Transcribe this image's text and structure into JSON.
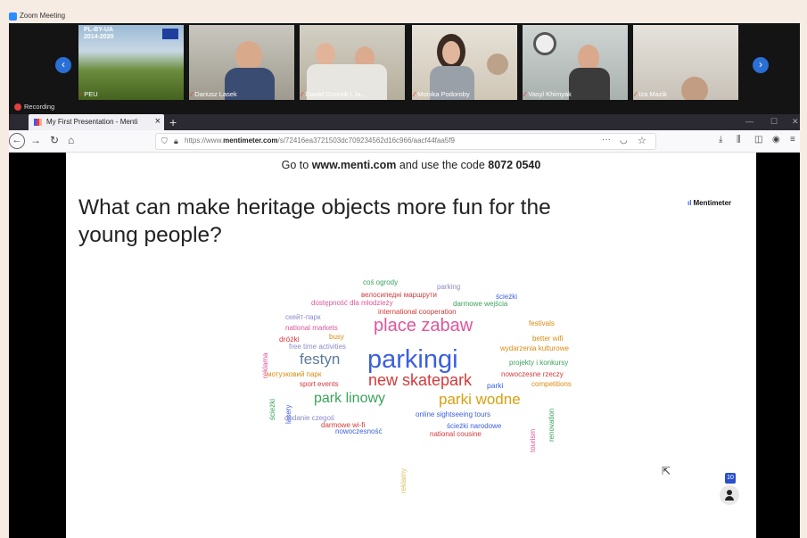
{
  "zoom": {
    "window_title": "Zoom Meeting",
    "recording_label": "Recording",
    "participants": [
      {
        "name": "PEU"
      },
      {
        "name": "Dariusz Lasek"
      },
      {
        "name": "Dawid Grzesik i Ja..."
      },
      {
        "name": "Monika Podoroby"
      },
      {
        "name": "Vasyl Khimyak"
      },
      {
        "name": "Iza Mazik"
      }
    ],
    "banner_text": {
      "line1": "PL-BY-UA",
      "line2": "2014-2020"
    }
  },
  "browser": {
    "tab_title": "My First Presentation - Menti",
    "url_prefix": "https://www.",
    "url_domain": "mentimeter.com",
    "url_path": "/s/72416ea3721503dc709234562d16c966/aacf44faa5f9"
  },
  "slide": {
    "join_text_pre": "Go to ",
    "join_site": "www.menti.com",
    "join_text_mid": " and use the code ",
    "join_code": "8072 0540",
    "question_line1": "What can make heritage objects more fun for the",
    "question_line2": "young people?",
    "brand": "Mentimeter",
    "participant_count": "10"
  },
  "word_cloud": [
    {
      "text": "coś ogrody",
      "color": "#3aa35a"
    },
    {
      "text": "parking",
      "color": "#8a8acd"
    },
    {
      "text": "велосипедні маршрути",
      "color": "#d43a3a"
    },
    {
      "text": "ścieżki",
      "color": "#3b5fe0"
    },
    {
      "text": "dostępność dla młodzieży",
      "color": "#e0559a"
    },
    {
      "text": "darmowe wejścia",
      "color": "#3aa35a"
    },
    {
      "text": "international cooperation",
      "color": "#d43a3a"
    },
    {
      "text": "скейт-парк",
      "color": "#8a8acd"
    },
    {
      "text": "festivals",
      "color": "#d98b10"
    },
    {
      "text": "national markets",
      "color": "#e0559a"
    },
    {
      "text": "place zabaw",
      "color": "#e0559a"
    },
    {
      "text": "dróżki",
      "color": "#d43a3a"
    },
    {
      "text": "busy",
      "color": "#d98b10"
    },
    {
      "text": "better wifi",
      "color": "#d98b10"
    },
    {
      "text": "free time activities",
      "color": "#8a8acd"
    },
    {
      "text": "wydarzenia kulturowe",
      "color": "#d98b10"
    },
    {
      "text": "reklama",
      "color": "#e0559a"
    },
    {
      "text": "festyn",
      "color": "#5c7a99"
    },
    {
      "text": "parkingi",
      "color": "#3b5fe0"
    },
    {
      "text": "projekty i konkursy",
      "color": "#3aa35a"
    },
    {
      "text": "мотузковий парк",
      "color": "#d98b10"
    },
    {
      "text": "new skatepark",
      "color": "#d43a3a"
    },
    {
      "text": "nowoczesne rzeczy",
      "color": "#d43a3a"
    },
    {
      "text": "sport events",
      "color": "#d43a3a"
    },
    {
      "text": "parki",
      "color": "#3b5fe0"
    },
    {
      "text": "competitions",
      "color": "#d98b10"
    },
    {
      "text": "ścieżki",
      "color": "#3aa35a"
    },
    {
      "text": "park linowy",
      "color": "#3aa35a"
    },
    {
      "text": "parki wodne",
      "color": "#d9a010"
    },
    {
      "text": "lasery",
      "color": "#3b5fe0"
    },
    {
      "text": "dodanie czegoś",
      "color": "#8a8acd"
    },
    {
      "text": "online sightseeing tours",
      "color": "#3b5fe0"
    },
    {
      "text": "renovation",
      "color": "#3aa35a"
    },
    {
      "text": "darmowe wi-fi",
      "color": "#d43a3a"
    },
    {
      "text": "nowoczesność",
      "color": "#3b5fe0"
    },
    {
      "text": "ścieżki narodowe",
      "color": "#3b5fe0"
    },
    {
      "text": "national cousine",
      "color": "#d43a3a"
    },
    {
      "text": "tourism",
      "color": "#e0559a"
    },
    {
      "text": "reklamy",
      "color": "#d9c060"
    }
  ]
}
